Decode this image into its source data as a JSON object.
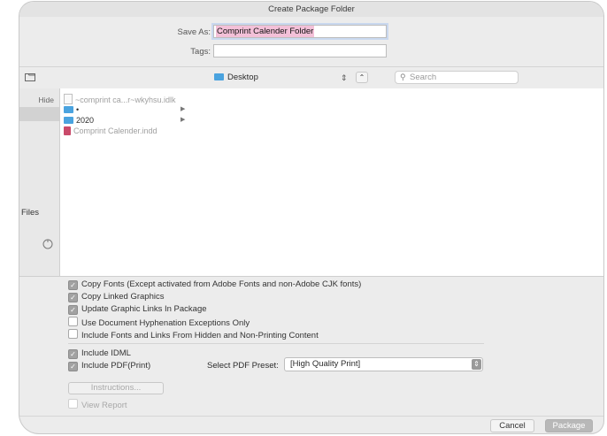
{
  "window": {
    "title": "Create Package Folder"
  },
  "save": {
    "save_as_label": "Save As:",
    "save_as_value": "Comprint Calender Folder",
    "tags_label": "Tags:",
    "tags_value": ""
  },
  "toolbar": {
    "location": "Desktop",
    "search_placeholder": "Search"
  },
  "sidebar": {
    "hide_label": "Hide",
    "files_label": "Files"
  },
  "files": [
    {
      "name": "~comprint ca...r~wkyhsu.idlk",
      "icon": "document-icon",
      "disabled": true,
      "has_children": false
    },
    {
      "name": "•",
      "icon": "folder-icon",
      "disabled": false,
      "has_children": true
    },
    {
      "name": "2020",
      "icon": "folder-icon",
      "disabled": false,
      "has_children": true
    },
    {
      "name": "Comprint Calender.indd",
      "icon": "indesign-file-icon",
      "disabled": true,
      "has_children": false
    }
  ],
  "options": {
    "copy_fonts": {
      "label": "Copy Fonts (Except activated from Adobe Fonts and non-Adobe CJK fonts)",
      "checked": true
    },
    "copy_graphics": {
      "label": "Copy Linked Graphics",
      "checked": true
    },
    "update_links": {
      "label": "Update Graphic Links In Package",
      "checked": true
    },
    "hyphenation": {
      "label": "Use Document Hyphenation Exceptions Only",
      "checked": false
    },
    "hidden_content": {
      "label": "Include Fonts and Links From Hidden and Non-Printing Content",
      "checked": false
    },
    "include_idml": {
      "label": "Include IDML",
      "checked": true
    },
    "include_pdf": {
      "label": "Include PDF(Print)",
      "checked": true
    },
    "pdf_preset_label": "Select PDF Preset:",
    "pdf_preset_value": "[High Quality Print]",
    "instructions_label": "Instructions...",
    "view_report": {
      "label": "View Report",
      "checked": false
    }
  },
  "footer": {
    "cancel_label": "Cancel",
    "package_label": "Package"
  },
  "colors": {
    "window_bg": "#ececec",
    "selection": "#f3c0d8",
    "folder": "#4aa3df",
    "indd": "#c94a6a",
    "primary_button": "#b8b8b8"
  }
}
